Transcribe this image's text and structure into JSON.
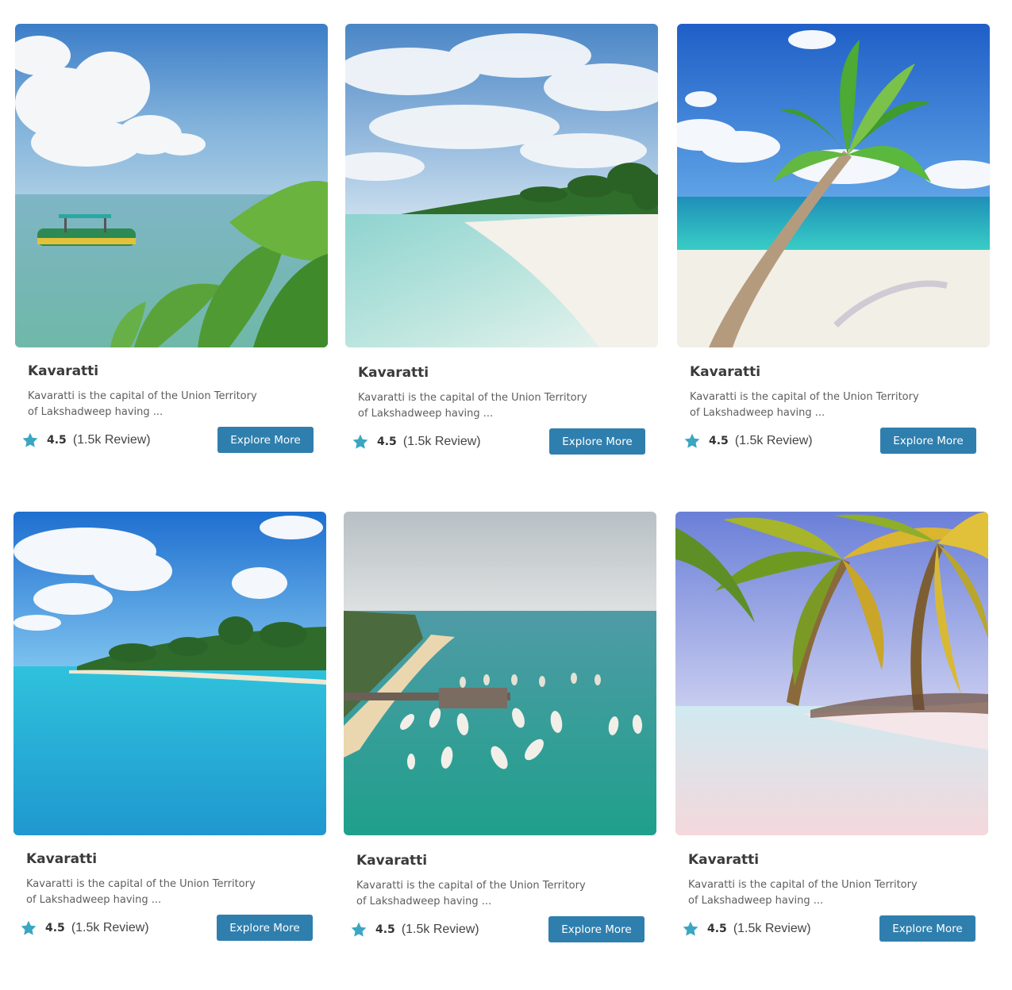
{
  "cards": [
    {
      "title": "Kavaratti",
      "description": "Kavaratti is the capital of the Union Territory of Lakshadweep having ...",
      "rating": "4.5",
      "reviews": "(1.5k Review)",
      "button_label": "Explore More"
    },
    {
      "title": "Kavaratti",
      "description": "Kavaratti is the capital of the Union Territory of Lakshadweep having ...",
      "rating": "4.5",
      "reviews": "(1.5k Review)",
      "button_label": "Explore More"
    },
    {
      "title": "Kavaratti",
      "description": "Kavaratti is the capital of the Union Territory of Lakshadweep having ...",
      "rating": "4.5",
      "reviews": "(1.5k Review)",
      "button_label": "Explore More"
    },
    {
      "title": "Kavaratti",
      "description": "Kavaratti is the capital of the Union Territory of Lakshadweep having ...",
      "rating": "4.5",
      "reviews": "(1.5k Review)",
      "button_label": "Explore More"
    },
    {
      "title": "Kavaratti",
      "description": "Kavaratti is the capital of the Union Territory of Lakshadweep having ...",
      "rating": "4.5",
      "reviews": "(1.5k Review)",
      "button_label": "Explore More"
    },
    {
      "title": "Kavaratti",
      "description": "Kavaratti is the capital of the Union Territory of Lakshadweep having ...",
      "rating": "4.5",
      "reviews": "(1.5k Review)",
      "button_label": "Explore More"
    }
  ],
  "colors": {
    "accent": "#2f7fae",
    "star": "#3aa6c2"
  },
  "icons": {
    "rating": "star-icon"
  }
}
